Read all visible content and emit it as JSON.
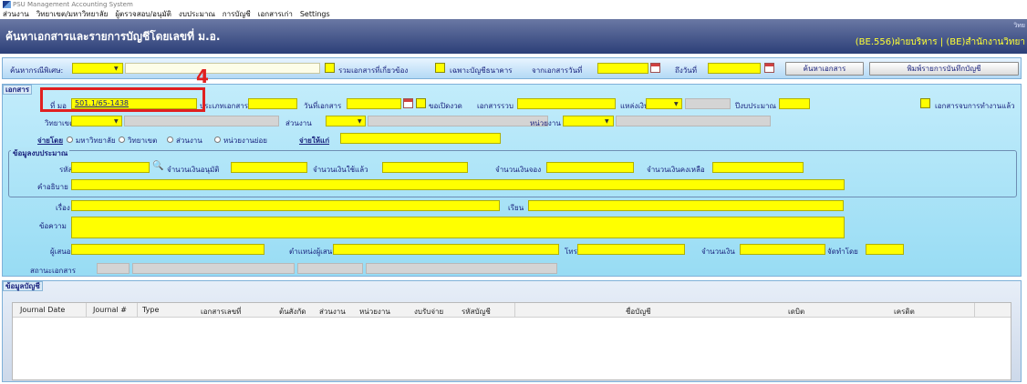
{
  "window": {
    "title": "PSU Management Accounting System"
  },
  "menu": [
    "ส่วนงาน",
    "วิทยาเขต/มหาวิทยาลัย",
    "ผู้ตรวจสอบ/อนุมัติ",
    "งบประมาณ",
    "การบัญชี",
    "เอกสารเก่า",
    "Settings"
  ],
  "header": {
    "title": "ค้นหาเอกสารและรายการบัญชีโดยเลขที่ ม.อ.",
    "org_top": "วิทย",
    "org": "(BE.556)ฝ่ายบริหาร | (BE)สำนักงานวิทยา"
  },
  "search": {
    "special_label": "ค้นหากรณีพิเศษ:",
    "related_label": "รวมเอกสารที่เกี่ยวข้อง",
    "bank_only_label": "เฉพาะบัญชีธนาคาร",
    "from_date_label": "จากเอกสารวันที่",
    "to_date_label": "ถึงวันที่",
    "search_button": "ค้นหาเอกสาร",
    "print_button": "พิมพ์รายการบันทึกบัญชี"
  },
  "doc": {
    "legend": "เอกสาร",
    "doc_no_label": "ที่ มอ",
    "doc_no_value": "501.1/65-1438",
    "doc_type_label": "ประเภทเอกสาร",
    "doc_date_label": "วันที่เอกสาร",
    "reopen_label": "ขอเปิดงวด",
    "ref_doc_label": "เอกสารรวบ",
    "fund_label": "แหล่งเงิน",
    "budget_year_label": "ปีงบประมาณ",
    "closed_label": "เอกสารจบการทำงานแล้ว",
    "campus_label": "วิทยาเขต",
    "division_label": "ส่วนงาน",
    "unit_label": "หน่วยงาน",
    "pay_by_label": "จ่ายโดย",
    "pay_options": [
      "มหาวิทยาลัย",
      "วิทยาเขต",
      "ส่วนงาน",
      "หน่วยงานย่อย"
    ],
    "pay_to_label": "จ่ายให้แก่",
    "budget_legend": "ข้อมูลงบประมาณ",
    "code_label": "รหัส",
    "approved_label": "จำนวนเงินอนุมัติ",
    "used_label": "จำนวนเงินใช้แล้ว",
    "reserved_label": "จำนวนเงินจอง",
    "remaining_label": "จำนวนเงินคงเหลือ",
    "description_label": "คำอธิบาย",
    "subject_label": "เรื่อง",
    "to_label": "เรียน",
    "message_label": "ข้อความ",
    "proposer_label": "ผู้เสนอ",
    "proposer_pos_label": "ตำแหน่งผู้เสนอ",
    "phone_label": "โทร",
    "amount_label": "จำนวนเงิน",
    "prepared_by_label": "จัดทำโดย",
    "status_label": "สถานะเอกสาร"
  },
  "annotation": {
    "step": "4"
  },
  "accounts": {
    "legend": "ข้อมูลบัญชี",
    "columns": [
      "Journal Date",
      "Journal #",
      "Type",
      "เอกสารเลขที่",
      "ต้นสังกัด",
      "ส่วนงาน",
      "หน่วยงาน",
      "งบรับจ่าย",
      "รหัสบัญชี",
      "ชื่อบัญชี",
      "เดบิต",
      "เครดิต"
    ]
  }
}
